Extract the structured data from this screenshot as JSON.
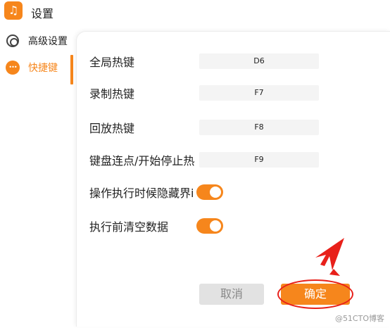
{
  "window": {
    "title": "设置",
    "logo_icon": "app-logo-icon"
  },
  "sidebar": {
    "items": [
      {
        "label": "高级设置",
        "icon": "gear-icon",
        "active": false
      },
      {
        "label": "快捷键",
        "icon": "dots-icon",
        "active": true
      }
    ]
  },
  "hotkeys": [
    {
      "label": "全局热键",
      "value": "D6"
    },
    {
      "label": "录制热键",
      "value": "F7"
    },
    {
      "label": "回放热键",
      "value": "F8"
    },
    {
      "label": "键盘连点/开始停止热",
      "value": "F9"
    }
  ],
  "toggles": [
    {
      "label": "操作执行时候隐藏界i",
      "on": true
    },
    {
      "label": "执行前清空数据",
      "on": true
    }
  ],
  "buttons": {
    "cancel": "取消",
    "confirm": "确定"
  },
  "watermark": "@51CTO博客",
  "colors": {
    "accent": "#f6861c",
    "highlight": "#e8201a",
    "cancel_bg": "#e2e2e2"
  }
}
